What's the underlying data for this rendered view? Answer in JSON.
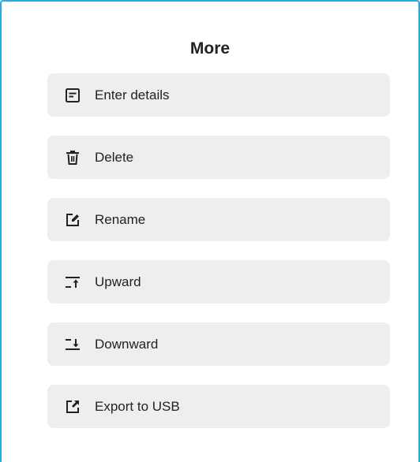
{
  "dialog": {
    "title": "More",
    "accent_color": "#29a8e0",
    "items": [
      {
        "label": "Enter details",
        "icon": "details-icon"
      },
      {
        "label": "Delete",
        "icon": "trash-icon"
      },
      {
        "label": "Rename",
        "icon": "edit-icon"
      },
      {
        "label": "Upward",
        "icon": "move-up-icon"
      },
      {
        "label": "Downward",
        "icon": "move-down-icon"
      },
      {
        "label": "Export to USB",
        "icon": "export-icon"
      }
    ]
  }
}
